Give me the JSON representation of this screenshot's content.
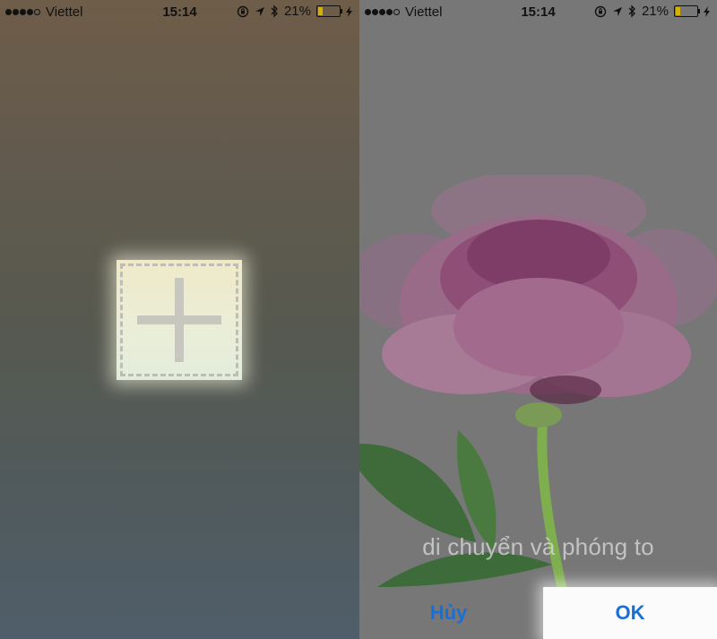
{
  "status_bar": {
    "carrier": "Viettel",
    "time": "15:14",
    "battery": "21%",
    "battery_level": 0.21,
    "icons": [
      "orientation-lock-icon",
      "location-icon",
      "bluetooth-icon",
      "charging-icon"
    ]
  },
  "editor": {
    "hint": "di chuyển và phóng to",
    "cancel_label": "Hủy",
    "ok_label": "OK"
  },
  "colors": {
    "accent": "#1a6fd6",
    "battery_fill": "#d8b000"
  }
}
